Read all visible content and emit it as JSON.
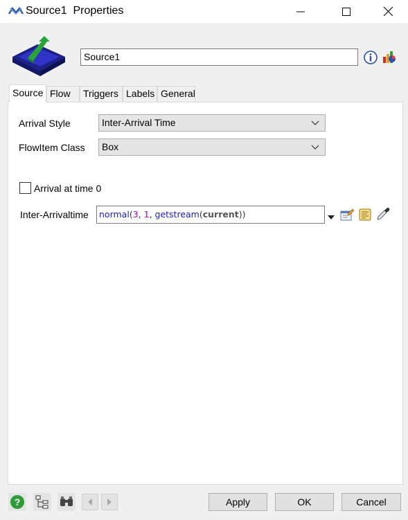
{
  "window": {
    "title": "Source1  Properties",
    "icon": "flexsim-app-icon",
    "controls": [
      "minimize-icon",
      "maximize-icon",
      "close-icon"
    ]
  },
  "header": {
    "object_icon": "source-object-icon",
    "name_value": "Source1",
    "icons": [
      "info-icon",
      "statistics-chart-icon"
    ]
  },
  "tabs": [
    {
      "label": "Source",
      "active": true
    },
    {
      "label": "Flow",
      "active": false
    },
    {
      "label": "Triggers",
      "active": false
    },
    {
      "label": "Labels",
      "active": false
    },
    {
      "label": "General",
      "active": false
    }
  ],
  "source_tab": {
    "arrival_style": {
      "label": "Arrival Style",
      "value": "Inter-Arrival Time"
    },
    "flowitem_class": {
      "label": "FlowItem Class",
      "value": "Box"
    },
    "arrival_at_time_zero": {
      "label": "Arrival at time 0",
      "checked": false
    },
    "inter_arrival": {
      "label": "Inter-Arrivaltime",
      "tokens": {
        "fn1": "normal",
        "p1": "(",
        "n1": "3",
        "c1": ", ",
        "n2": "1",
        "c2": ", ",
        "fn2": "getstream",
        "p2": "(",
        "kw": "current",
        "p3": "))"
      },
      "tools": [
        "dropdown-arrow-icon",
        "edit-properties-icon",
        "code-script-icon",
        "eyedropper-icon"
      ]
    }
  },
  "footer": {
    "icons": [
      "help-icon",
      "tree-view-icon",
      "binoculars-icon"
    ],
    "nav": [
      "back-arrow-icon",
      "forward-arrow-icon"
    ],
    "buttons": {
      "apply": "Apply",
      "ok": "OK",
      "cancel": "Cancel"
    }
  },
  "colors": {
    "window_bg": "#f0f0f0",
    "panel_bg": "#ffffff",
    "select_bg": "#e5e5e5",
    "code_function": "#1e1eb4",
    "code_number": "#b000b0"
  }
}
